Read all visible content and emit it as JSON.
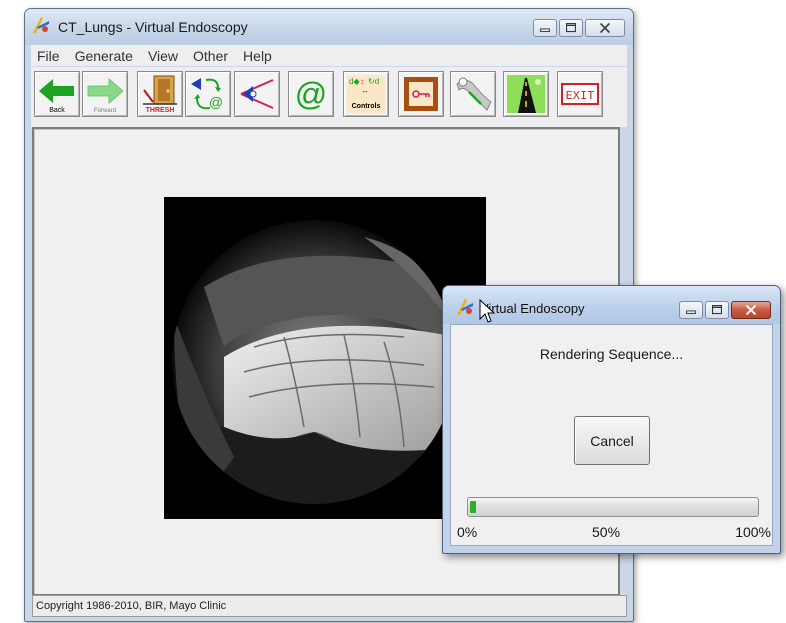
{
  "main_window": {
    "title": "CT_Lungs - Virtual Endoscopy",
    "menu": [
      "File",
      "Generate",
      "View",
      "Other",
      "Help"
    ],
    "toolbar": {
      "back_label": "Back",
      "forward_label": "Forward",
      "thresh_label": "THRESH",
      "controls_label": "Controls",
      "exit_label": "EXIT"
    },
    "status": "Copyright 1986-2010, BIR, Mayo Clinic"
  },
  "dialog": {
    "title": "Virtual Endoscopy",
    "message": "Rendering Sequence...",
    "cancel_label": "Cancel",
    "progress": 0.02,
    "progress_ticks": [
      "0%",
      "50%",
      "100%"
    ]
  },
  "colors": {
    "progress_fill": "#2fae2b",
    "back_arrow": "#1ea31e",
    "forward_arrow": "#8ad98a",
    "exit_red": "#d42020"
  }
}
